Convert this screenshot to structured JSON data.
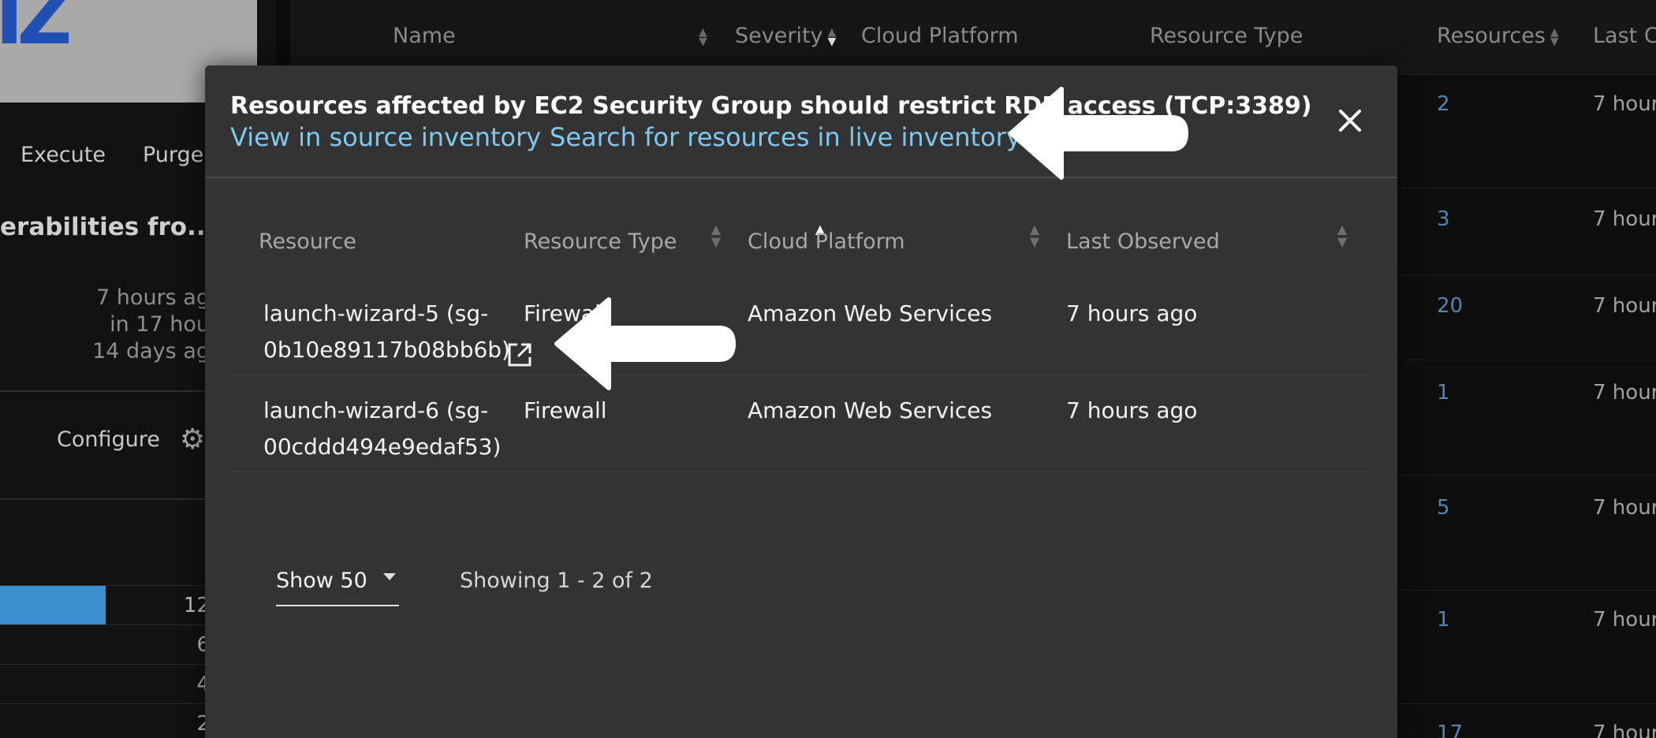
{
  "background": {
    "logo_text": "IZ",
    "actions": [
      "Execute",
      "Purge"
    ],
    "vulnerability_title": "erabilities fro...",
    "meta": [
      "7 hours ag",
      "in 17 hou",
      "14 days ag"
    ],
    "configure_label": "Configure",
    "mini_values": [
      "12",
      "6",
      "4",
      "2"
    ],
    "table_headers": {
      "name": "Name",
      "severity": "Severity",
      "cloud_platform": "Cloud Platform",
      "resource_type": "Resource Type",
      "resources": "Resources",
      "last": "Last C"
    },
    "rows": [
      {
        "count": "2",
        "last": "7 hour"
      },
      {
        "count": "3",
        "last": "7 hour"
      },
      {
        "count": "20",
        "last": "7 hour"
      },
      {
        "count": "1",
        "last": "7 hour"
      },
      {
        "count": "5",
        "last": "7 hour"
      },
      {
        "count": "1",
        "last": "7 hour"
      },
      {
        "count": "17",
        "last": "7 hour"
      }
    ]
  },
  "modal": {
    "title": "Resources affected by EC2 Security Group should restrict RDP access (TCP:3389)",
    "link_source": "View in source inventory",
    "link_live": "Search for resources in live inventory",
    "columns": [
      "Resource",
      "Resource Type",
      "Cloud Platform",
      "Last Observed"
    ],
    "rows": [
      {
        "resource_line1": "launch-wizard-5 (sg-",
        "resource_line2": "0b10e89117b08bb6b)",
        "type": "Firewall",
        "platform": "Amazon Web Services",
        "observed": "7 hours ago"
      },
      {
        "resource_line1": "launch-wizard-6 (sg-",
        "resource_line2": "00cddd494e9edaf53)",
        "type": "Firewall",
        "platform": "Amazon Web Services",
        "observed": "7 hours ago"
      }
    ],
    "page_size": "Show 50",
    "showing": "Showing 1 - 2 of 2"
  },
  "colors": {
    "link": "#7fc8f0",
    "modal_bg": "#333333",
    "count_link": "#4f86b4",
    "bar": "#3a8fcf"
  }
}
